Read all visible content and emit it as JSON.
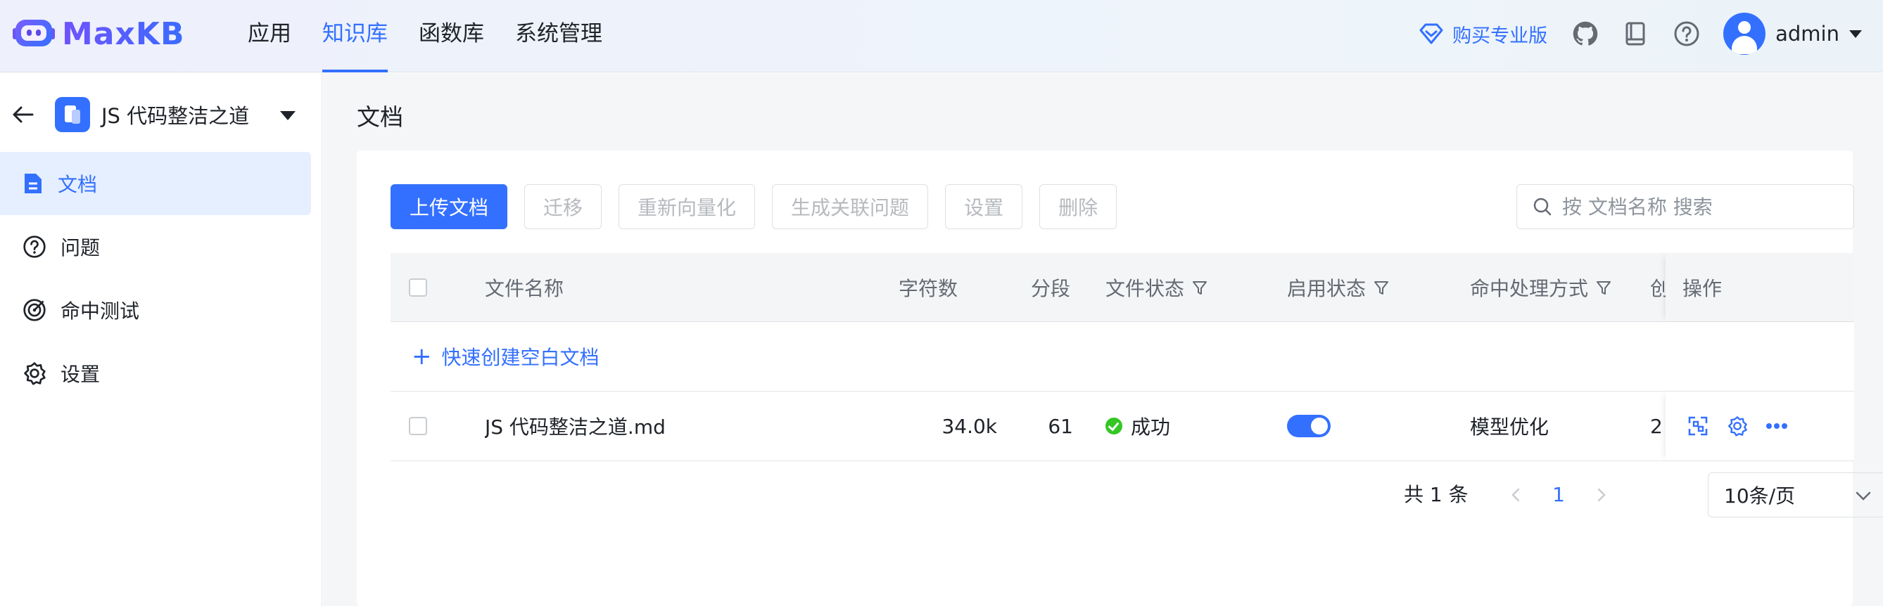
{
  "brand": {
    "name": "MaxKB"
  },
  "nav": {
    "items": [
      {
        "label": "应用"
      },
      {
        "label": "知识库"
      },
      {
        "label": "函数库"
      },
      {
        "label": "系统管理"
      }
    ],
    "active": "知识库"
  },
  "header": {
    "buy_pro": "购买专业版",
    "icons": [
      "github-icon",
      "docs-book-icon",
      "help-icon"
    ],
    "user": "admin"
  },
  "sidebar": {
    "kb_name": "JS 代码整洁之道",
    "items": [
      {
        "label": "文档",
        "icon": "document-icon",
        "active": true
      },
      {
        "label": "问题",
        "icon": "question-icon"
      },
      {
        "label": "命中测试",
        "icon": "target-icon"
      },
      {
        "label": "设置",
        "icon": "gear-icon"
      }
    ]
  },
  "page": {
    "title": "文档"
  },
  "toolbar": {
    "upload": "上传文档",
    "migrate": "迁移",
    "revectorize": "重新向量化",
    "gen_questions": "生成关联问题",
    "settings": "设置",
    "delete": "删除"
  },
  "search": {
    "placeholder": "按 文档名称 搜索"
  },
  "table": {
    "columns": {
      "name": "文件名称",
      "chars": "字符数",
      "segments": "分段",
      "file_status": "文件状态",
      "enable_status": "启用状态",
      "hit_method": "命中处理方式",
      "created_truncated": "创",
      "actions": "操作"
    },
    "quick_create": "快速创建空白文档",
    "rows": [
      {
        "name": "JS 代码整洁之道.md",
        "chars": "34.0k",
        "segments": "61",
        "file_status": "成功",
        "enabled": true,
        "hit_method": "模型优化",
        "created_truncated": "2"
      }
    ]
  },
  "pagination": {
    "total": "共 1 条",
    "current": "1",
    "page_size": "10条/页"
  },
  "colors": {
    "primary": "#3370ff",
    "success": "#34c724"
  }
}
